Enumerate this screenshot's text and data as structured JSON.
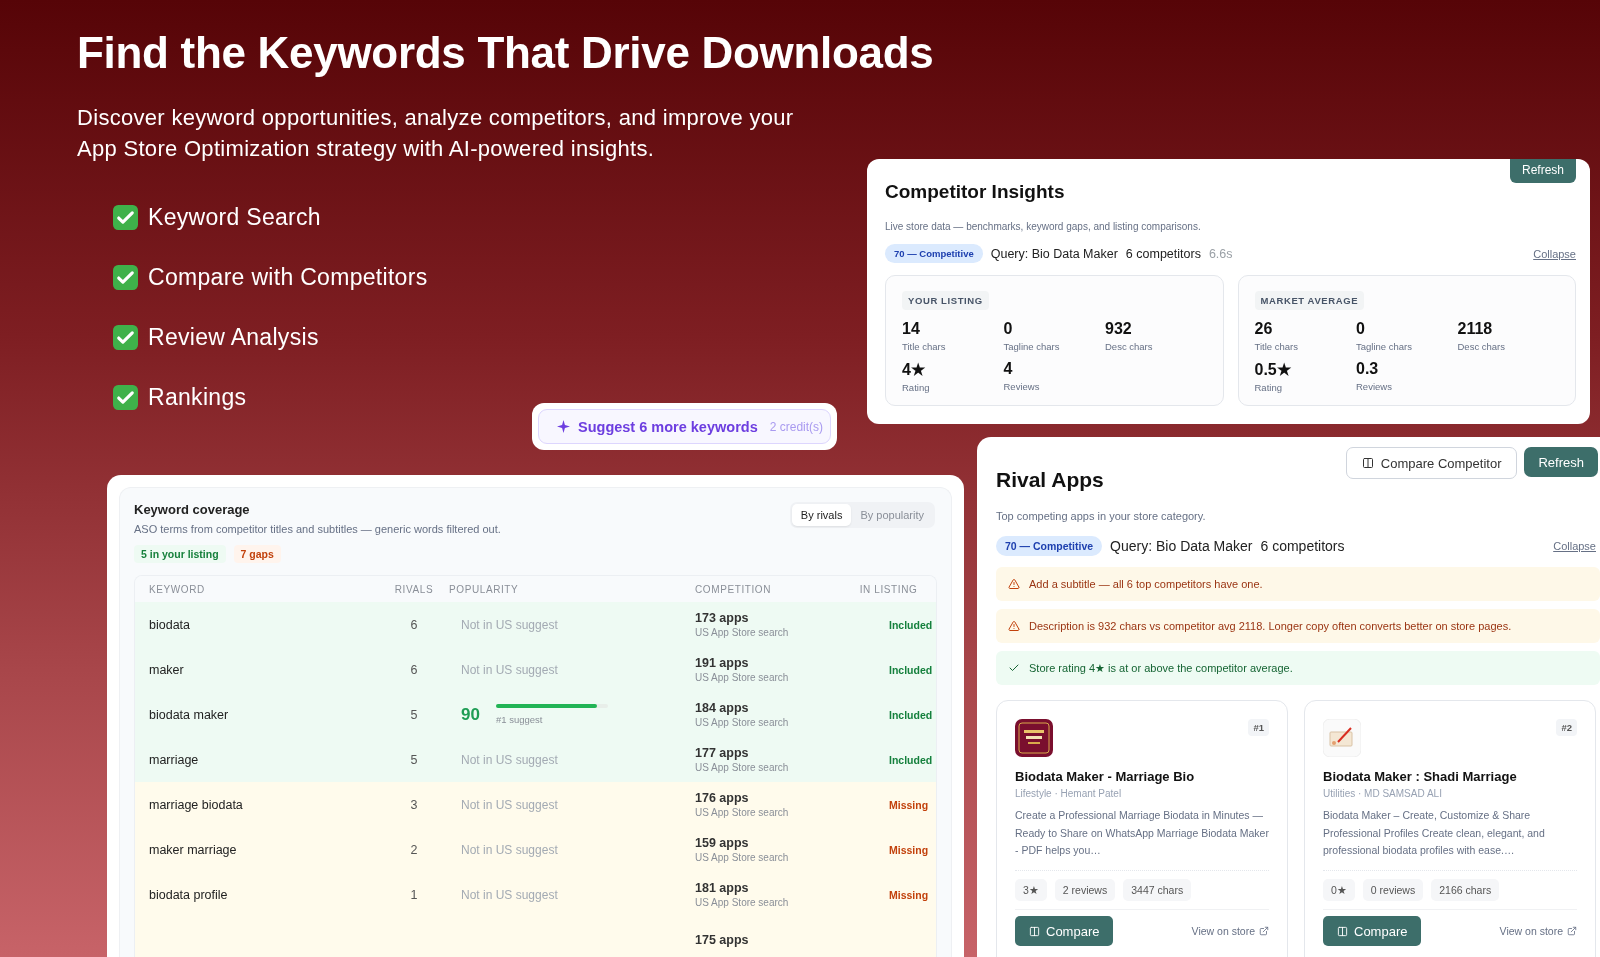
{
  "hero": {
    "title": "Find the Keywords That Drive Downloads",
    "subtitle": "Discover keyword opportunities, analyze competitors, and improve your App Store Optimization strategy with AI-powered insights.",
    "features": [
      {
        "label": "Keyword Search"
      },
      {
        "label": "Compare with Competitors"
      },
      {
        "label": "Review Analysis"
      },
      {
        "label": "Rankings"
      }
    ]
  },
  "suggest_button": {
    "label": "Suggest 6 more keywords",
    "cost": "2 credit(s)"
  },
  "competitor_insights": {
    "title": "Competitor Insights",
    "refresh": "Refresh",
    "description": "Live store data — benchmarks, keyword gaps, and listing comparisons.",
    "score_badge": "70 — Competitive",
    "query": "Query: Bio Data Maker",
    "competitors": "6 competitors",
    "duration": "6.6s",
    "collapse": "Collapse",
    "panels": [
      {
        "label": "YOUR LISTING",
        "stats": [
          {
            "value": "14",
            "label": "Title chars"
          },
          {
            "value": "0",
            "label": "Tagline chars"
          },
          {
            "value": "932",
            "label": "Desc chars"
          },
          {
            "value": "4★",
            "label": "Rating"
          },
          {
            "value": "4",
            "label": "Reviews"
          }
        ]
      },
      {
        "label": "MARKET AVERAGE",
        "stats": [
          {
            "value": "26",
            "label": "Title chars"
          },
          {
            "value": "0",
            "label": "Tagline chars"
          },
          {
            "value": "2118",
            "label": "Desc chars"
          },
          {
            "value": "0.5★",
            "label": "Rating"
          },
          {
            "value": "0.3",
            "label": "Reviews"
          }
        ]
      }
    ]
  },
  "keyword_coverage": {
    "title": "Keyword coverage",
    "description": "ASO terms from competitor titles and subtitles — generic words filtered out.",
    "sort_options": [
      {
        "label": "By rivals",
        "selected": true
      },
      {
        "label": "By popularity",
        "selected": false
      }
    ],
    "included_count": "5 in your listing",
    "gaps_count": "7 gaps",
    "columns": [
      "KEYWORD",
      "RIVALS",
      "POPULARITY",
      "COMPETITION",
      "IN LISTING"
    ],
    "rows": [
      {
        "keyword": "biodata",
        "rivals": "6",
        "popularity": {
          "kind": "none",
          "text": "Not in US suggest"
        },
        "competition": "173 apps",
        "competition_note": "US App Store search",
        "status": "Included",
        "included": true
      },
      {
        "keyword": "maker",
        "rivals": "6",
        "popularity": {
          "kind": "none",
          "text": "Not in US suggest"
        },
        "competition": "191 apps",
        "competition_note": "US App Store search",
        "status": "Included",
        "included": true
      },
      {
        "keyword": "biodata maker",
        "rivals": "5",
        "popularity": {
          "kind": "score",
          "text": "90",
          "level": 0.9,
          "note": "#1 suggest"
        },
        "competition": "184 apps",
        "competition_note": "US App Store search",
        "status": "Included",
        "included": true
      },
      {
        "keyword": "marriage",
        "rivals": "5",
        "popularity": {
          "kind": "none",
          "text": "Not in US suggest"
        },
        "competition": "177 apps",
        "competition_note": "US App Store search",
        "status": "Included",
        "included": true
      },
      {
        "keyword": "marriage biodata",
        "rivals": "3",
        "popularity": {
          "kind": "none",
          "text": "Not in US suggest"
        },
        "competition": "176 apps",
        "competition_note": "US App Store search",
        "status": "Missing",
        "included": false
      },
      {
        "keyword": "maker marriage",
        "rivals": "2",
        "popularity": {
          "kind": "none",
          "text": "Not in US suggest"
        },
        "competition": "159 apps",
        "competition_note": "US App Store search",
        "status": "Missing",
        "included": false
      },
      {
        "keyword": "biodata profile",
        "rivals": "1",
        "popularity": {
          "kind": "none",
          "text": "Not in US suggest"
        },
        "competition": "181 apps",
        "competition_note": "US App Store search",
        "status": "Missing",
        "included": false
      },
      {
        "competition": "175 apps",
        "included": false
      }
    ]
  },
  "rival_apps": {
    "title": "Rival Apps",
    "compare_button": "Compare Competitor",
    "refresh": "Refresh",
    "description": "Top competing apps in your store category.",
    "score_badge": "70 — Competitive",
    "query": "Query: Bio Data Maker",
    "competitors": "6 competitors",
    "collapse": "Collapse",
    "alerts": [
      {
        "kind": "warning",
        "text": "Add a subtitle — all 6 top competitors have one."
      },
      {
        "kind": "warning",
        "text": "Description is 932 chars vs competitor avg 2118. Longer copy often converts better on store pages."
      },
      {
        "kind": "success",
        "text": "Store rating 4★ is at or above the competitor average."
      }
    ],
    "apps": [
      {
        "rank": "#1",
        "name": "Biodata Maker - Marriage Bio",
        "meta": "Lifestyle · Hemant Patel",
        "description": "Create a Professional Marriage Biodata in Minutes — Ready to Share on WhatsApp Marriage Biodata Maker - PDF helps you…",
        "stats": [
          "3★",
          "2 reviews",
          "3447 chars"
        ],
        "compare": "Compare",
        "store_link": "View on store"
      },
      {
        "rank": "#2",
        "name": "Biodata Maker : Shadi Marriage",
        "meta": "Utilities · MD SAMSAD ALI",
        "description": "Biodata Maker – Create, Customize & Share Professional Profiles Create clean, elegant, and professional biodata profiles with ease.…",
        "stats": [
          "0★",
          "0 reviews",
          "2166 chars"
        ],
        "compare": "Compare",
        "store_link": "View on store"
      }
    ]
  }
}
